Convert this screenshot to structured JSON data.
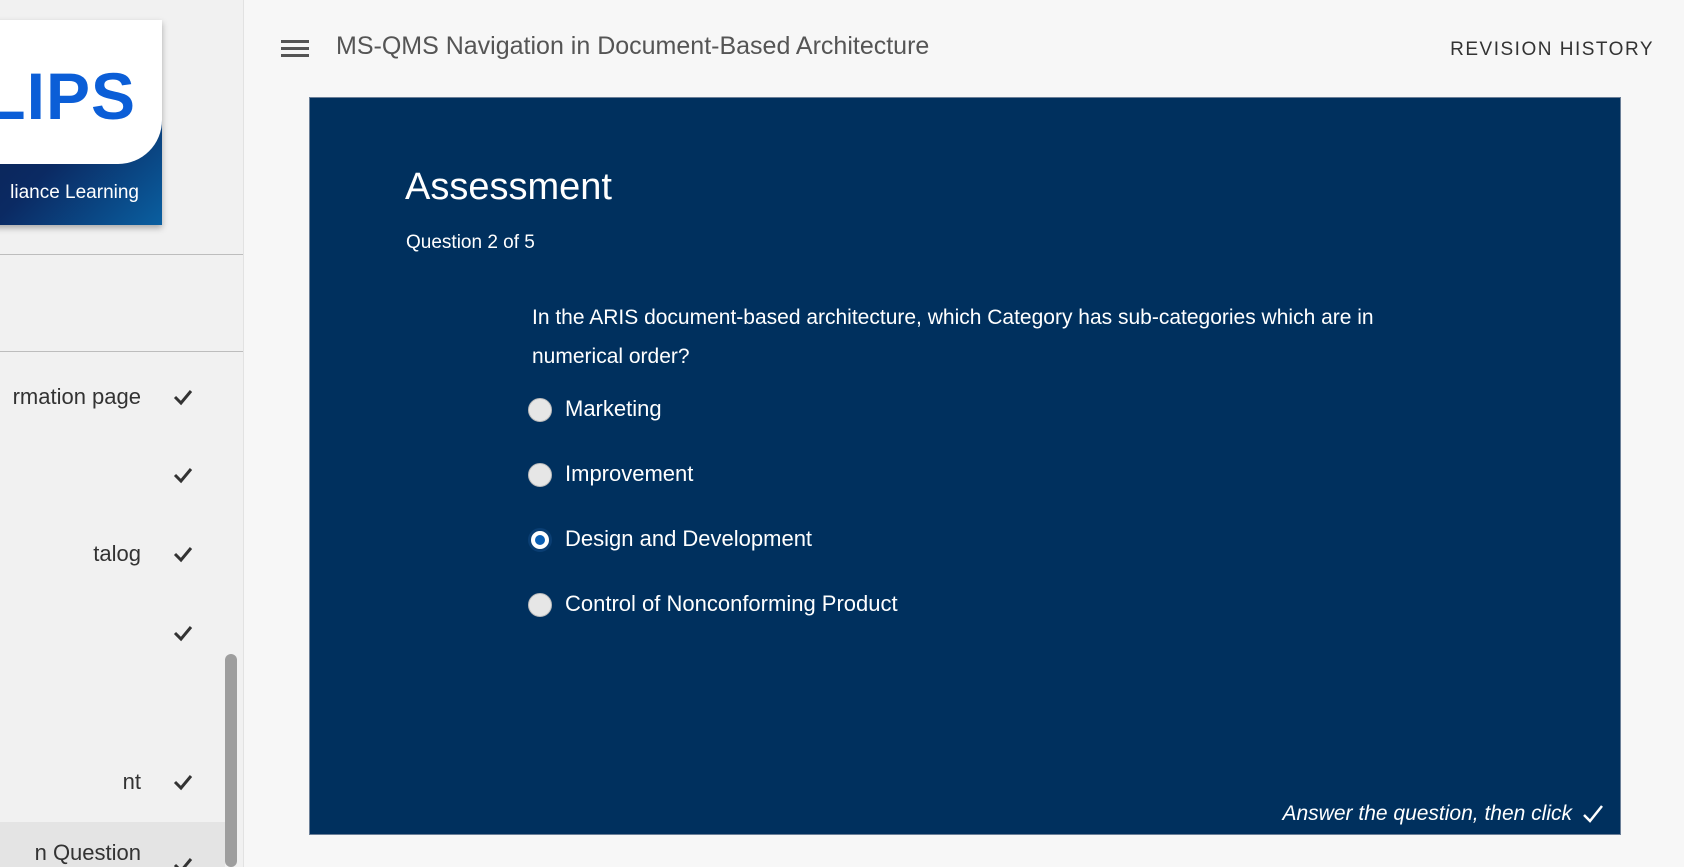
{
  "header": {
    "title": "MS-QMS Navigation in Document-Based Architecture",
    "revision_history": "REVISION HISTORY"
  },
  "logo": {
    "wordmark": "LIPS",
    "subtitle": "liance Learning"
  },
  "sidebar": {
    "items": [
      {
        "label": "rmation page",
        "completed": true
      },
      {
        "label": "",
        "completed": true
      },
      {
        "label": "talog",
        "completed": true
      },
      {
        "label": "",
        "completed": true
      },
      {
        "label": "nt",
        "completed": true
      },
      {
        "label": "n Question",
        "completed": true
      }
    ]
  },
  "assessment": {
    "title": "Assessment",
    "progress": "Question 2 of 5",
    "question": "In the ARIS document-based architecture, which Category has sub-categories which are in numerical order?",
    "options": [
      {
        "label": "Marketing",
        "selected": false
      },
      {
        "label": "Improvement",
        "selected": false
      },
      {
        "label": "Design and Development",
        "selected": true
      },
      {
        "label": "Control of Nonconforming Product",
        "selected": false
      }
    ],
    "footer_hint": "Answer the question, then click"
  },
  "colors": {
    "panel_bg": "#00305e",
    "brand_blue": "#0b5ed7"
  }
}
